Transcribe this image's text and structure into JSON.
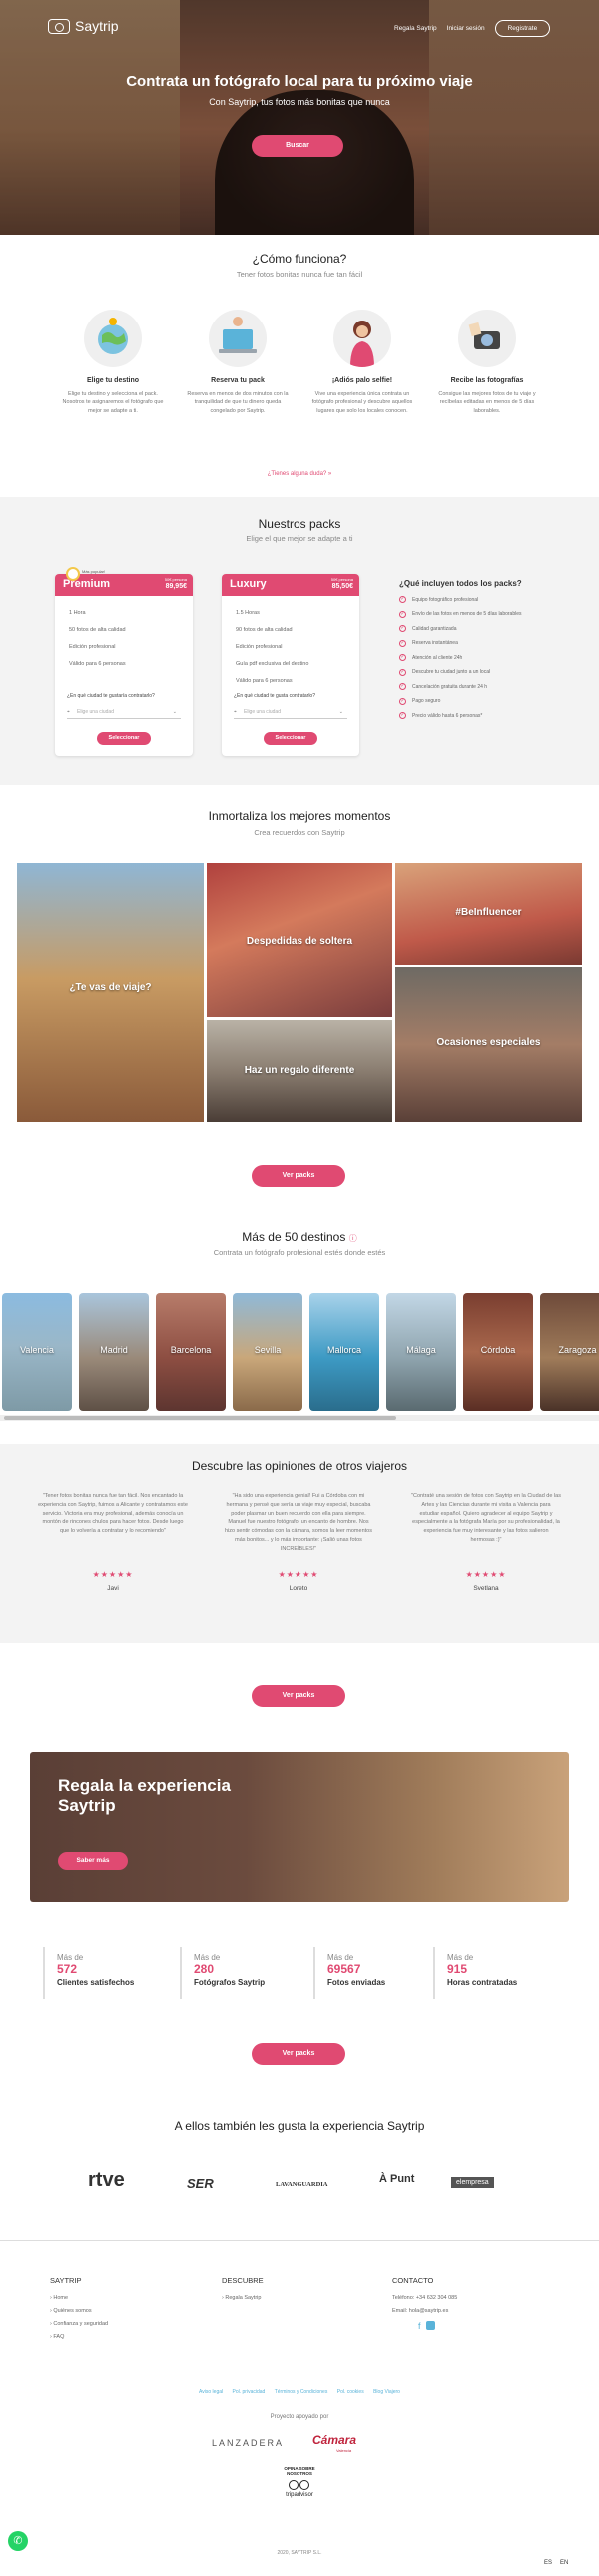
{
  "header": {
    "logo_text": "Saytrip",
    "nav": [
      "Regala Saytrip",
      "Iniciar sesión"
    ],
    "register": "Registrate"
  },
  "hero": {
    "title": "Contrata un fotógrafo local para tu próximo viaje",
    "subtitle": "Con Saytrip, tus fotos más bonitas que nunca",
    "button": "Buscar"
  },
  "how": {
    "title": "¿Cómo funciona?",
    "subtitle": "Tener fotos bonitas nunca fue tan fácil",
    "steps": [
      {
        "title": "Elige tu destino",
        "text": "Elige tu destino y selecciona el pack. Nosotros te asignaremos el fotógrafo que mejor se adapte a ti.",
        "icon": "globe-illustration"
      },
      {
        "title": "Reserva tu pack",
        "text": "Reserva en menos de dos minutos con la tranquilidad de que tu dinero queda congelado por Saytrip.",
        "icon": "laptop-illustration"
      },
      {
        "title": "¡Adiós palo selfie!",
        "text": "Vive una experiencia única contrata un fotógrafo profesional y descubre aquellos lugares que solo los locales conocen.",
        "icon": "woman-illustration"
      },
      {
        "title": "Recibe las fotografías",
        "text": "Consigue las mejores fotos de tu viaje y recíbelas editadas en menos de 5 días laborables.",
        "icon": "camera-illustration"
      }
    ],
    "doubts_link": "¿Tienes alguna duda? »"
  },
  "packs": {
    "title": "Nuestros packs",
    "subtitle": "Elige el que mejor se adapte a ti",
    "badge": "Más popular!",
    "items": [
      {
        "name": "Premium",
        "from": "50€ persona",
        "price": "89,95€",
        "features": [
          "1 Hora",
          "50 fotos de alta calidad",
          "Edición profesional",
          "Válido para 6 personas"
        ],
        "question": "¿En qué ciudad te gustaría contratarlo?",
        "placeholder": "Elige una ciudad",
        "button": "Seleccionar"
      },
      {
        "name": "Luxury",
        "from": "50€ persona",
        "price": "85,50€",
        "features": [
          "1.5 Horas",
          "90 fotos de alta calidad",
          "Edición profesional",
          "Guía pdf exclusiva del destino",
          "Válido para 6 personas"
        ],
        "question": "¿En qué ciudad te gusta contratarlo?",
        "placeholder": "Elige una ciudad",
        "button": "Seleccionar"
      }
    ],
    "includes_title": "¿Qué incluyen todos los packs?",
    "includes": [
      "Equipo fotográfico profesional",
      "Envío de las fotos en menos de 5 días laborables",
      "Calidad garantizada",
      "Reserva instantánea",
      "Atención al cliente 24h",
      "Descubre tu ciudad junto a un local",
      "Cancelación gratuita durante 24 h",
      "Pago seguro",
      "Precio válido hasta 6 personas*"
    ]
  },
  "moments": {
    "title": "Inmortaliza los mejores momentos",
    "subtitle": "Crea recuerdos con Saytrip",
    "tiles": [
      "¿Te vas de viaje?",
      "Despedidas de soltera",
      "#BeInfluencer",
      "Ocasiones especiales",
      "Haz un regalo diferente"
    ],
    "button": "Ver packs"
  },
  "destinations": {
    "title": "Más de 50 destinos",
    "subtitle": "Contrata un fotógrafo profesional estés donde estés",
    "cities": [
      "Valencia",
      "Madrid",
      "Barcelona",
      "Sevilla",
      "Mallorca",
      "Málaga",
      "Córdoba",
      "Zaragoza"
    ]
  },
  "reviews": {
    "title": "Descubre las opiniones de otros viajeros",
    "items": [
      {
        "text": "\"Tener fotos bonitas nunca fue tan fácil. Nos encantado la experiencia con Saytrip, fuimos a Alicante y contratamos este servicio. Victoria era muy profesional, además conocía un montón de rincones chulos para hacer fotos. Desde luego que lo volvería a contratar y lo recomiendo\"",
        "stars": "★★★★★",
        "name": "Javi"
      },
      {
        "text": "\"Ha sido una experiencia genial! Fui a Córdoba con mi hermana y pensé que sería un viaje muy especial, buscaba poder plasmar un buen recuerdo con ella para siempre. Manuel fue nuestro fotógrafo, un encanto de hombre. Nos hizo sentir cómodas con la cámara, somos la leer momentos más bonitos... y lo más importante: ¡Salió unas fotos INCREÍBLES!\"",
        "stars": "★★★★★",
        "name": "Loreto"
      },
      {
        "text": "\"Contraté una sesión de fotos con Saytrip en la Ciudad de las Artes y las Ciencias durante mi visita a Valencia para estudiar español. Quiero agradecer al equipo Saytrip y especialmente a la fotógrafa María por su profesionalidad, la experiencia fue muy interesante y las fotos salieron hermosas :)\"",
        "stars": "★★★★★",
        "name": "Svetlana"
      }
    ],
    "button": "Ver packs"
  },
  "gift": {
    "title_line1": "Regala la experiencia",
    "title_line2": "Saytrip",
    "button": "Saber más"
  },
  "stats": [
    {
      "pre": "Más de",
      "value": "572",
      "label": "Clientes satisfechos"
    },
    {
      "pre": "Más de",
      "value": "280",
      "label": "Fotógrafos Saytrip"
    },
    {
      "pre": "Más de",
      "value": "69567",
      "label": "Fotos enviadas"
    },
    {
      "pre": "Más de",
      "value": "915",
      "label": "Horas contratadas"
    }
  ],
  "stats_button": "Ver packs",
  "press": {
    "title": "A ellos también les gusta la experiencia Saytrip",
    "logos": [
      "rtve",
      "SER",
      "LAVANGUARDIA",
      "À Punt",
      "elempresa"
    ]
  },
  "footer": {
    "col1_title": "SAYTRIP",
    "col1_items": [
      "Home",
      "Quiénes somos",
      "Confianza y seguridad",
      "FAQ"
    ],
    "col2_title": "DESCUBRE",
    "col2_items": [
      "Regala Saytrip"
    ],
    "col3_title": "CONTACTO",
    "phone": "Teléfono: +34 632 304 085",
    "email": "Email: hola@saytrip.es",
    "links": [
      "Aviso legal",
      "Pol. privacidad",
      "Términos y Condiciones",
      "Pol. cookies",
      "Blog Viajero"
    ],
    "supported": "Proyecto apoyado por",
    "sponsor1": "LANZADERA",
    "sponsor2": "Cámara",
    "sponsor2_sub": "Valencia",
    "tripadvisor_top": "OPINA SOBRE NOSOTROS",
    "tripadvisor": "tripadvisor",
    "copyright": "2020, SAYTRIP S.L.",
    "lang": [
      "ES",
      "EN"
    ]
  }
}
